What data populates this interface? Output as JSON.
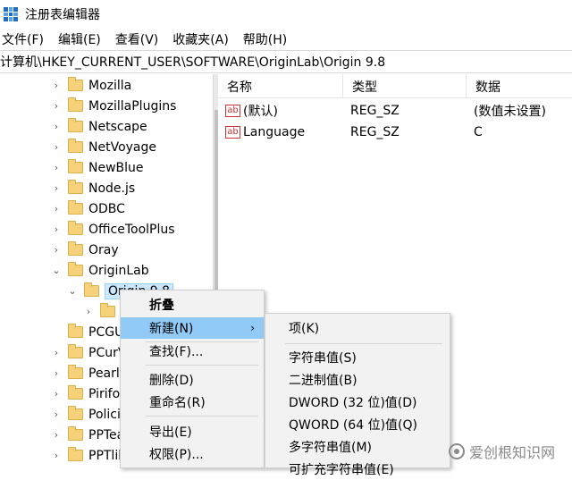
{
  "window": {
    "title": "注册表编辑器"
  },
  "menubar": [
    "文件(F)",
    "编辑(E)",
    "查看(V)",
    "收藏夹(A)",
    "帮助(H)"
  ],
  "address": "计算机\\HKEY_CURRENT_USER\\SOFTWARE\\OriginLab\\Origin 9.8",
  "tree": [
    {
      "label": "Mozilla",
      "chevron": "›"
    },
    {
      "label": "MozillaPlugins",
      "chevron": "›"
    },
    {
      "label": "Netscape",
      "chevron": "›"
    },
    {
      "label": "NetVoyage",
      "chevron": "›"
    },
    {
      "label": "NewBlue",
      "chevron": "›"
    },
    {
      "label": "Node.js",
      "chevron": "›"
    },
    {
      "label": "ODBC",
      "chevron": "›"
    },
    {
      "label": "OfficeToolPlus",
      "chevron": "›"
    },
    {
      "label": "Oray",
      "chevron": "›"
    },
    {
      "label": "OriginLab",
      "chevron": "⌄"
    },
    {
      "label": "Origin 9.8",
      "chevron": "⌄"
    },
    {
      "label": "",
      "chevron": "›"
    },
    {
      "label": "PCGU",
      "chevron": ""
    },
    {
      "label": "PCurV",
      "chevron": "›"
    },
    {
      "label": "Pearll",
      "chevron": "›"
    },
    {
      "label": "Pirifo",
      "chevron": "›"
    },
    {
      "label": "Polici",
      "chevron": "›"
    },
    {
      "label": "PPTea",
      "chevron": "›"
    },
    {
      "label": "PPTlib",
      "chevron": "›"
    }
  ],
  "list": {
    "headers": [
      "名称",
      "类型",
      "数据"
    ],
    "rows": [
      {
        "icon": "ab",
        "name": "(默认)",
        "type": "REG_SZ",
        "data": "(数值未设置)"
      },
      {
        "icon": "ab",
        "name": "Language",
        "type": "REG_SZ",
        "data": "C"
      }
    ]
  },
  "context_menu": {
    "items": [
      "折叠",
      "新建(N)",
      "查找(F)...",
      "删除(D)",
      "重命名(R)",
      "导出(E)",
      "权限(P)..."
    ],
    "arrow": "›"
  },
  "sub_menu": {
    "items": [
      "项(K)",
      "字符串值(S)",
      "二进制值(B)",
      "DWORD (32 位)值(D)",
      "QWORD (64 位)值(Q)",
      "多字符串值(M)",
      "可扩充字符串值(E)"
    ]
  },
  "watermark": "爱创根知识网",
  "colors": {
    "highlight": "#91c9f7",
    "selected": "#cce8ff",
    "folder": "#f5d27a"
  }
}
